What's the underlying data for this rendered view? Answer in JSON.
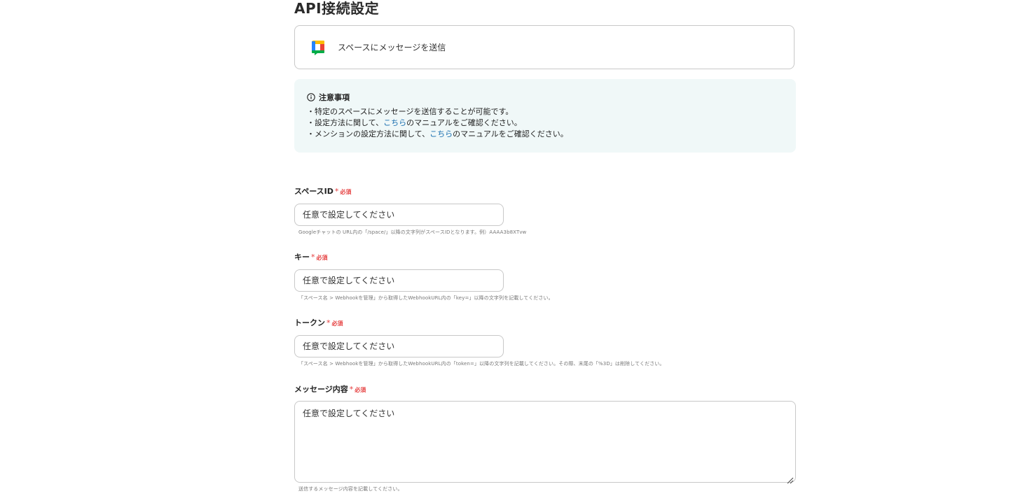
{
  "page": {
    "title": "API接続設定"
  },
  "action": {
    "label": "スペースにメッセージを送信",
    "icon": "google-chat-icon"
  },
  "notice": {
    "heading": "注意事項",
    "icon": "info-icon",
    "line1": "・特定のスペースにメッセージを送信することが可能です。",
    "line2_prefix": "・設定方法に関して、",
    "line2_link": "こちら",
    "line2_suffix": "のマニュアルをご確認ください。",
    "line3_prefix": "・メンションの設定方法に関して、",
    "line3_link": "こちら",
    "line3_suffix": "のマニュアルをご確認ください。"
  },
  "fields": {
    "space_id": {
      "label": "スペースID",
      "required_star": "*",
      "required_text": "必須",
      "placeholder": "任意で設定してください",
      "hint": "Googleチャットの URL内の「/space/」以降の文字列がスペースIDとなります。例）AAAA3b8XTvw"
    },
    "key": {
      "label": "キー",
      "required_star": "*",
      "required_text": "必須",
      "placeholder": "任意で設定してください",
      "hint": "「スペース名 > Webhookを管理」から取得したWebhookURL内の「key=」以降の文字列を記載してください。"
    },
    "token": {
      "label": "トークン",
      "required_star": "*",
      "required_text": "必須",
      "placeholder": "任意で設定してください",
      "hint": "「スペース名 > Webhookを管理」から取得したWebhookURL内の「token=」以降の文字列を記載してください。その際、末尾の「%3D」は削除してください。"
    },
    "message": {
      "label": "メッセージ内容",
      "required_star": "*",
      "required_text": "必須",
      "placeholder": "任意で設定してください",
      "hint": "送信するメッセージ内容を記載してください。"
    }
  },
  "colors": {
    "required": "#e53d3d",
    "link": "#1a6fb0",
    "notice_bg": "#f0f8f8",
    "border": "#c8c8c8"
  }
}
